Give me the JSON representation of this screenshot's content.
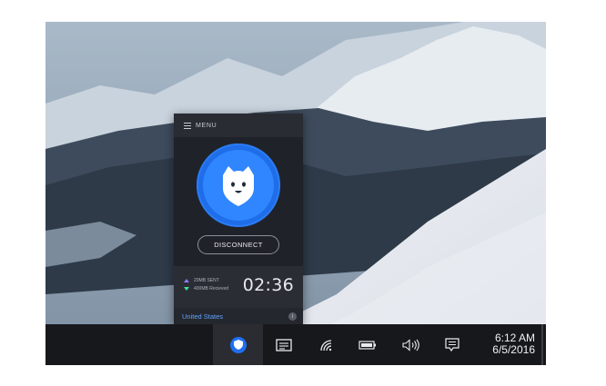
{
  "vpn_app": {
    "menu_label": "MENU",
    "disconnect_label": "DISCONNECT",
    "stats": {
      "sent": "20MB SENT",
      "received": "400MB Recieved",
      "timer": "02:36"
    },
    "location": "United States",
    "info_icon": "i"
  },
  "taskbar": {
    "time": "6:12 AM",
    "date": "6/5/2016",
    "icons": [
      "vpn-shield-icon",
      "notes-icon",
      "wifi-icon",
      "battery-icon",
      "volume-icon",
      "action-center-icon"
    ]
  },
  "colors": {
    "accent": "#2f86ff",
    "location_text": "#5fa4ff",
    "sent_arrow": "#8c7dff",
    "received_arrow": "#3fe0a0"
  }
}
